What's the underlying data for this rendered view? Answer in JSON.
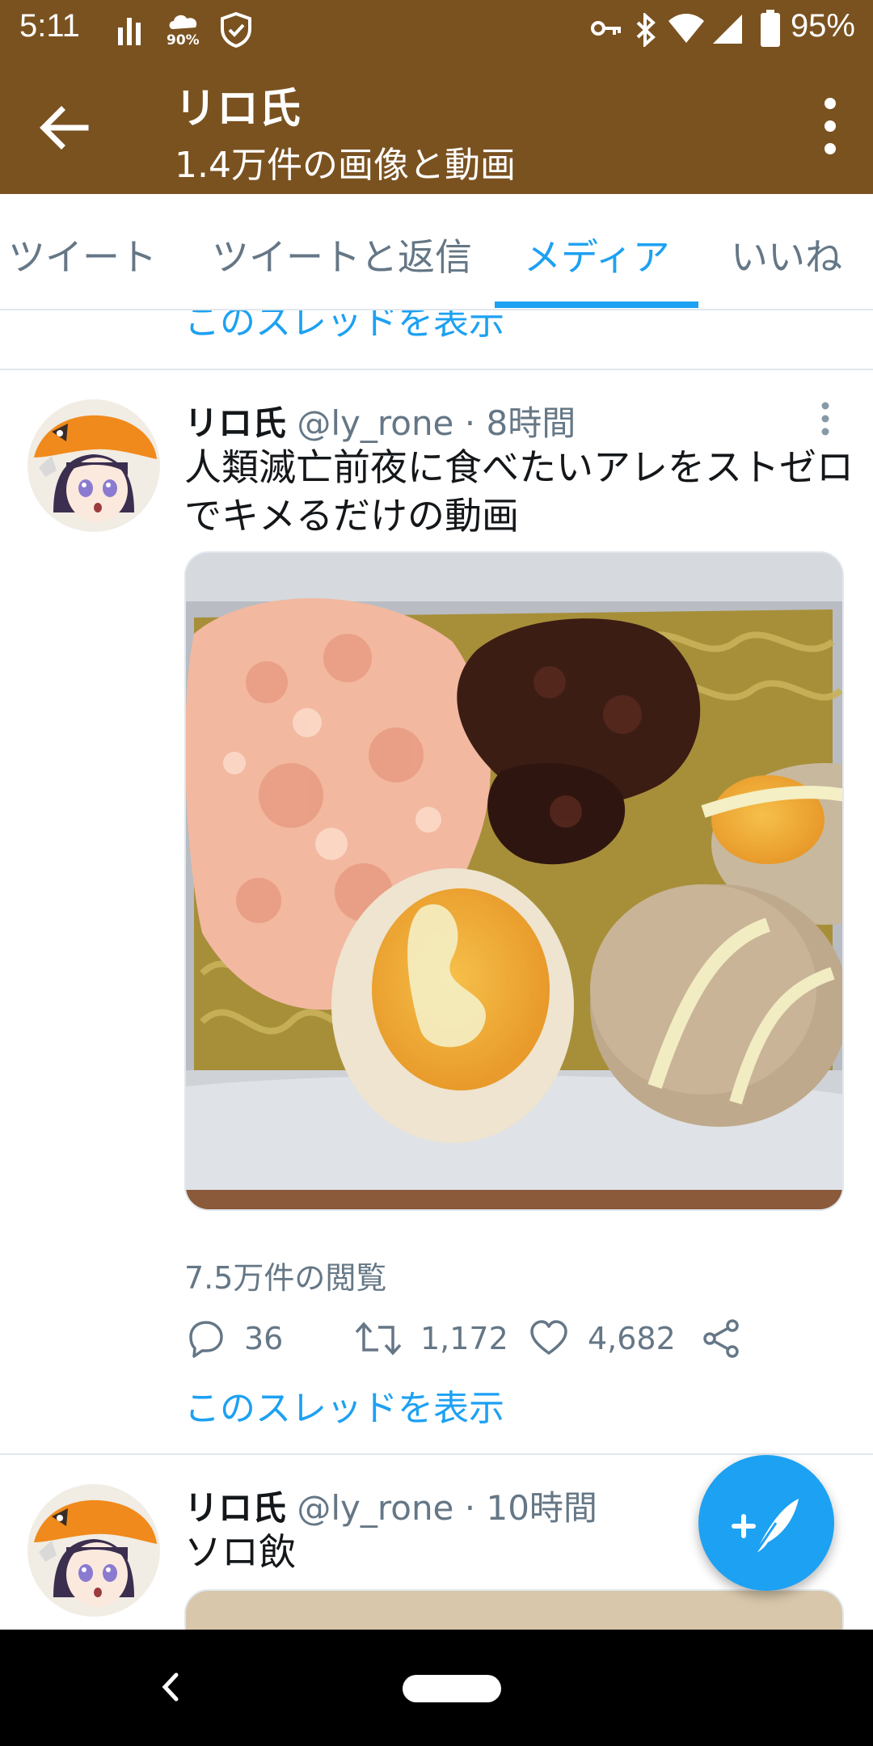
{
  "status_bar": {
    "time": "5:11",
    "network_badge": "90%",
    "battery": "95%",
    "icons": [
      "signal-bars-icon",
      "data-saver-icon",
      "shield-check-icon",
      "vpn-key-icon",
      "bluetooth-icon",
      "wifi-icon",
      "cell-signal-icon",
      "battery-icon"
    ]
  },
  "app_bar": {
    "title": "リロ氏",
    "subtitle": "1.4万件の画像と動画",
    "back_icon": "arrow-left-icon",
    "more_icon": "more-vertical-icon"
  },
  "tabs": [
    {
      "label": "ツイート",
      "active": false
    },
    {
      "label": "ツイートと返信",
      "active": false
    },
    {
      "label": "メディア",
      "active": true
    },
    {
      "label": "いいね",
      "active": false
    }
  ],
  "prev_thread_link": "このスレッドを表示",
  "tweets": [
    {
      "name": "リロ氏",
      "handle": "@ly_rone",
      "time": "8時間",
      "text": "人類滅亡前夜に食べたいアレをストゼロでキメるだけの動画",
      "views": "7.5万件の閲覧",
      "replies": "36",
      "retweets": "1,172",
      "likes": "4,682",
      "thread_link": "このスレッドを表示"
    },
    {
      "name": "リロ氏",
      "handle": "@ly_rone",
      "time": "10時間",
      "text": "ソロ飲"
    }
  ],
  "colors": {
    "app_bar": "#7a5220",
    "accent": "#1da1f2",
    "secondary_text": "#657786"
  },
  "fab_icon": "compose-tweet-icon"
}
